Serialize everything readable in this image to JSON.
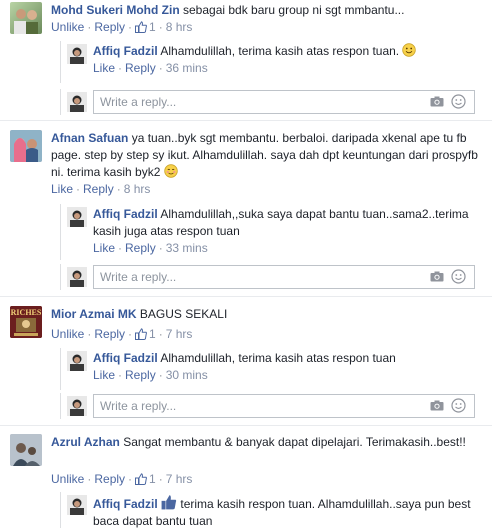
{
  "actions": {
    "unlike": "Unlike",
    "like": "Like",
    "reply": "Reply",
    "separator": "·",
    "write_placeholder": "Write a reply..."
  },
  "comments": [
    {
      "name": "Mohd Sukeri Mohd Zin",
      "text": "sebagai bdk baru group ni sgt mmbantu...",
      "likes": "1",
      "time": "8 hrs",
      "reply": {
        "name": "Affiq Fadzil",
        "text": "Alhamdulillah, terima kasih atas respon tuan.",
        "time": "36 mins"
      }
    },
    {
      "name": "Afnan Safuan",
      "text": "ya tuan..byk sgt membantu. berbaloi. daripada xkenal ape tu fb page. step by step sy ikut. Alhamdulillah. saya dah dpt keuntungan dari prospyfb ni. terima kasih byk2",
      "time": "8 hrs",
      "reply": {
        "name": "Affiq Fadzil",
        "text": "Alhamdulillah,,suka saya dapat bantu tuan..sama2..terima kasih juga atas respon tuan",
        "time": "33 mins"
      }
    },
    {
      "name": "Mior Azmai MK",
      "text": "BAGUS SEKALI",
      "likes": "1",
      "time": "7 hrs",
      "reply": {
        "name": "Affiq Fadzil",
        "text": "Alhamdulillah, terima kasih atas respon tuan",
        "time": "30 mins"
      }
    },
    {
      "name": "Azrul Azhan",
      "text": "Sangat membantu & banyak dapat dipelajari. Terimakasih..best!!",
      "likes": "1",
      "time": "7 hrs",
      "reply": {
        "name": "Affiq Fadzil",
        "text": "terima kasih respon tuan. Alhamdulillah..saya pun best baca dapat bantu tuan"
      }
    }
  ],
  "colors": {
    "name": "#365899",
    "link": "#4b67a1",
    "meta": "#90949c",
    "border": "#dddfe2"
  },
  "icons": [
    "thumbs-up-icon",
    "camera-icon",
    "smile-icon",
    "smiley-emoji",
    "blush-emoji"
  ]
}
